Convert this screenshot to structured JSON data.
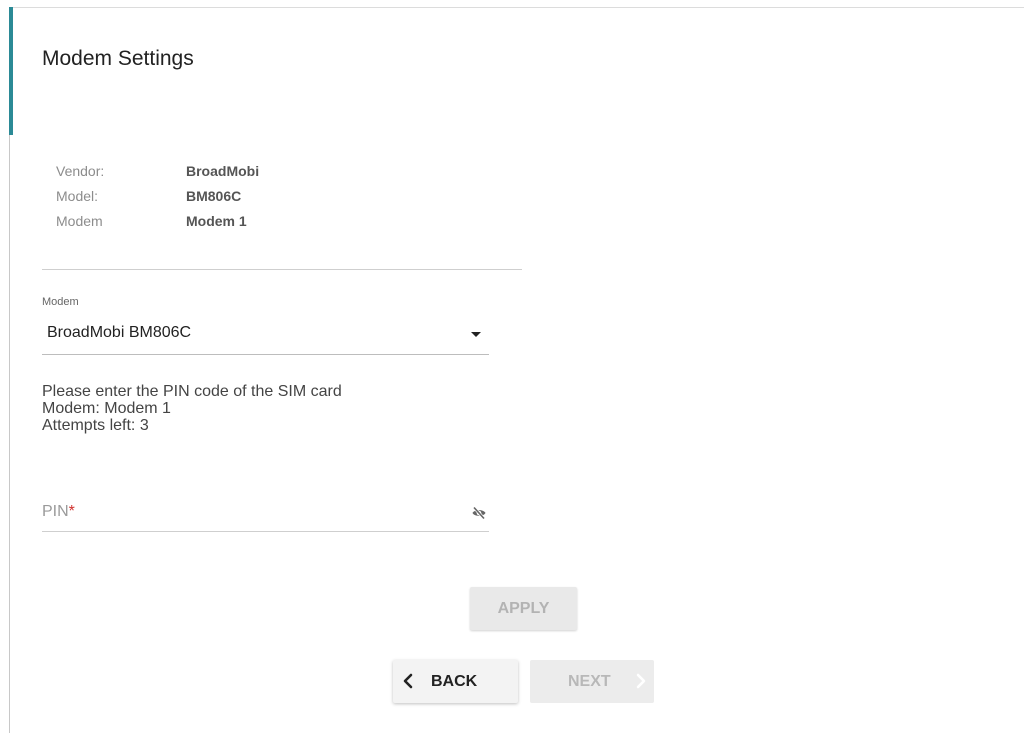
{
  "page": {
    "title": "Modem Settings"
  },
  "info": {
    "rows": [
      {
        "label": "Vendor:",
        "value": "BroadMobi"
      },
      {
        "label": "Model:",
        "value": "BM806C"
      },
      {
        "label": "Modem",
        "value": "Modem 1"
      }
    ]
  },
  "modem_select": {
    "label": "Modem",
    "value": "BroadMobi BM806C"
  },
  "message": {
    "lines": [
      "Please enter the PIN code of the SIM card",
      "Modem: Modem 1",
      "Attempts left: 3"
    ]
  },
  "pin": {
    "label": "PIN",
    "required_mark": "*",
    "value": "",
    "toggle_icon": "eye-off-icon"
  },
  "buttons": {
    "apply": "APPLY",
    "back": "BACK",
    "next": "NEXT"
  },
  "colors": {
    "accent": "#2b8a96",
    "required": "#d0312d",
    "disabled_text": "#b3b3b3"
  }
}
